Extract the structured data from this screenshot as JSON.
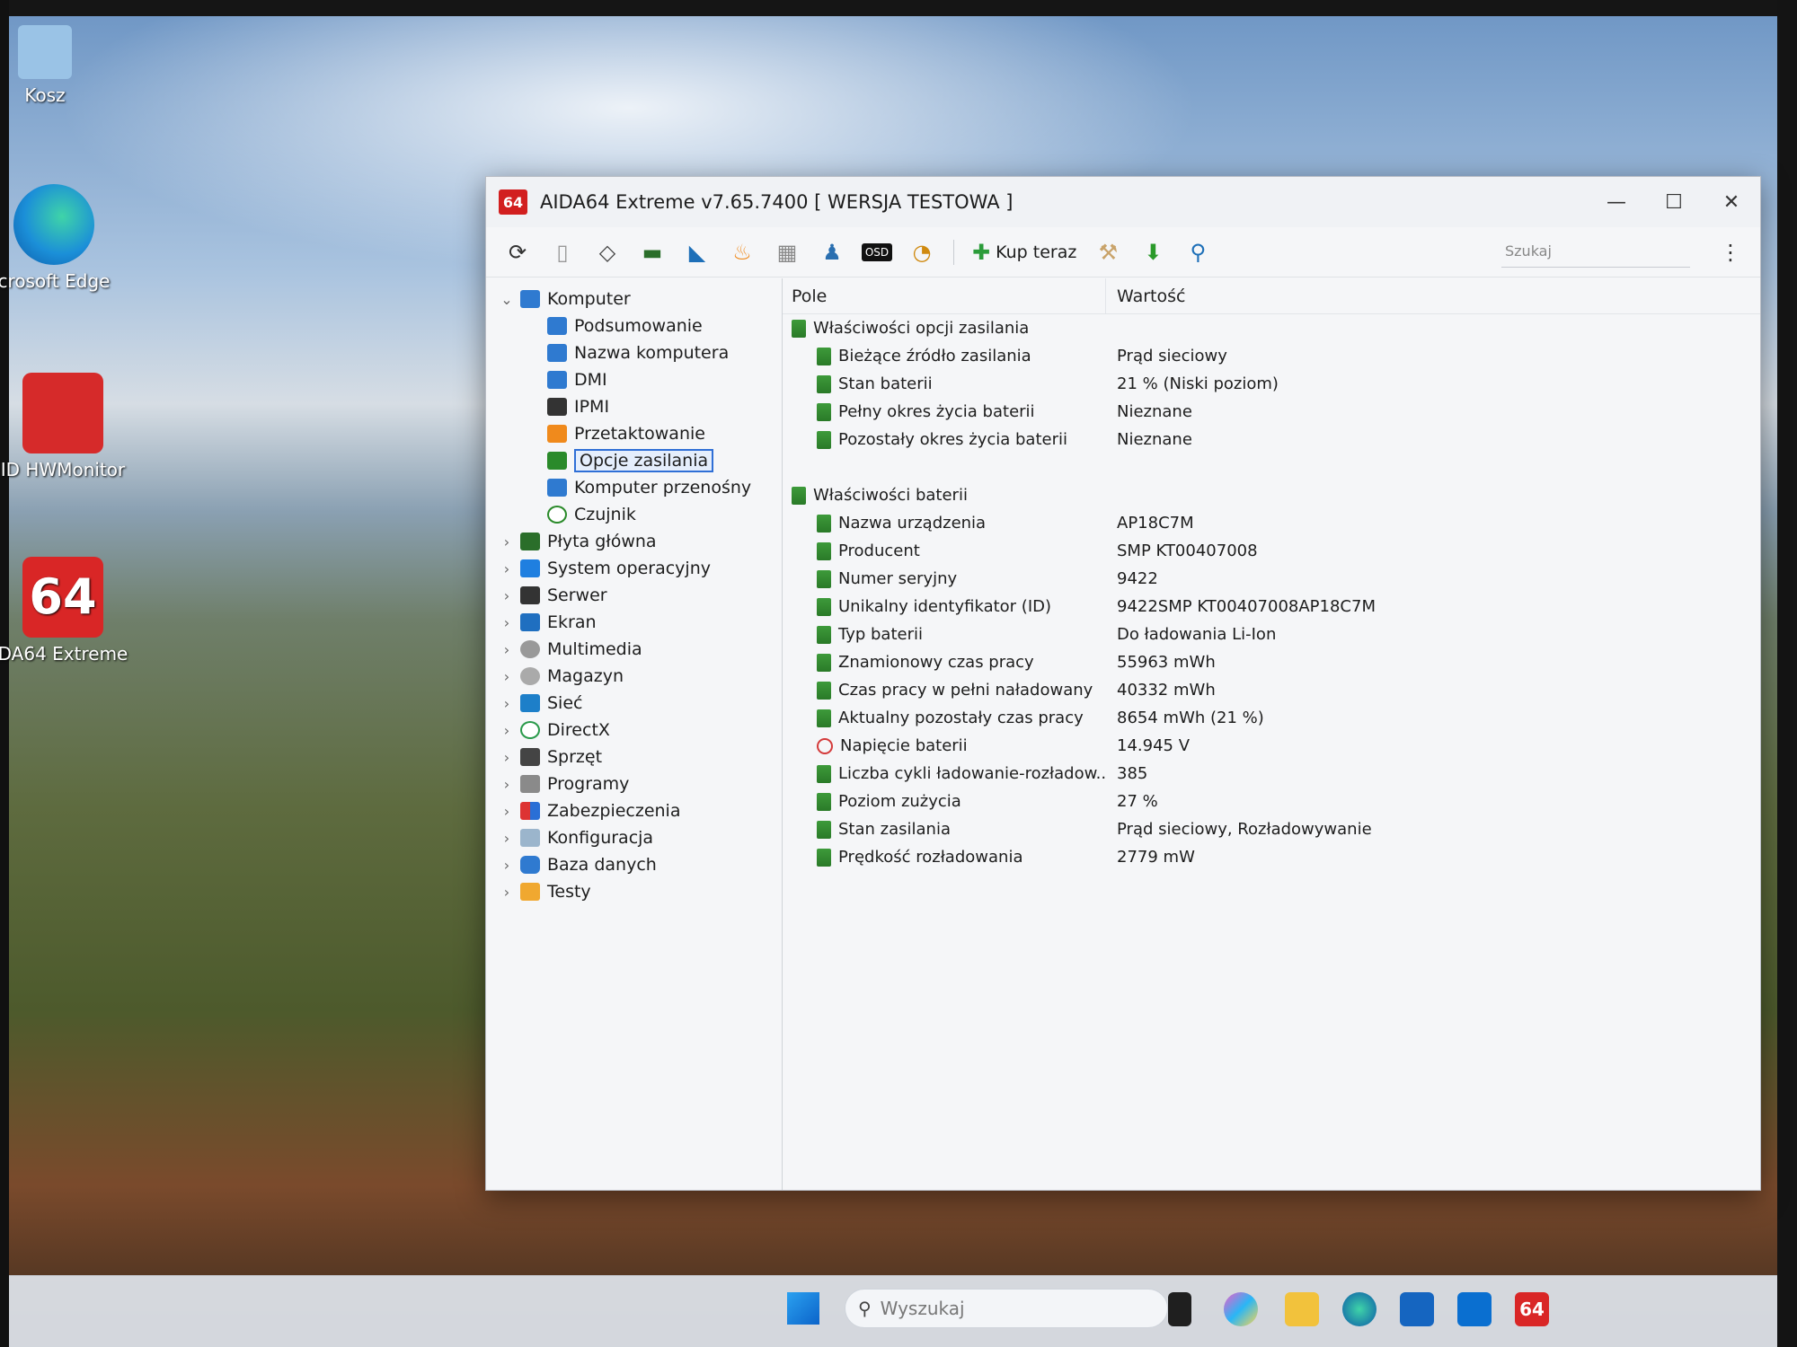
{
  "desktop": {
    "icons": [
      {
        "label": "Kosz",
        "icon": "recycle-bin-icon"
      },
      {
        "label": "crosoft Edge",
        "icon": "edge-icon"
      },
      {
        "label": "ID HWMonitor",
        "icon": "hwmonitor-icon"
      },
      {
        "label": "DA64 Extreme",
        "icon": "aida64-icon"
      }
    ]
  },
  "window": {
    "logo": "64",
    "title": "AIDA64 Extreme v7.65.7400  [ WERSJA TESTOWA ]",
    "controls": {
      "minimize": "—",
      "maximize": "☐",
      "close": "✕"
    }
  },
  "toolbar": {
    "buy_label": "Kup teraz",
    "search_placeholder": "Szukaj",
    "more": "⋮"
  },
  "tree": {
    "root": {
      "label": "Komputer"
    },
    "children": [
      {
        "label": "Podsumowanie"
      },
      {
        "label": "Nazwa komputera"
      },
      {
        "label": "DMI"
      },
      {
        "label": "IPMI"
      },
      {
        "label": "Przetaktowanie"
      },
      {
        "label": "Opcje zasilania"
      },
      {
        "label": "Komputer przenośny"
      },
      {
        "label": "Czujnik"
      }
    ],
    "sections": [
      {
        "label": "Płyta główna"
      },
      {
        "label": "System operacyjny"
      },
      {
        "label": "Serwer"
      },
      {
        "label": "Ekran"
      },
      {
        "label": "Multimedia"
      },
      {
        "label": "Magazyn"
      },
      {
        "label": "Sieć"
      },
      {
        "label": "DirectX"
      },
      {
        "label": "Sprzęt"
      },
      {
        "label": "Programy"
      },
      {
        "label": "Zabezpieczenia"
      },
      {
        "label": "Konfiguracja"
      },
      {
        "label": "Baza danych"
      },
      {
        "label": "Testy"
      }
    ]
  },
  "list": {
    "col_field": "Pole",
    "col_value": "Wartość",
    "group1": {
      "title": "Właściwości opcji zasilania",
      "rows": [
        {
          "field": "Bieżące źródło zasilania",
          "value": "Prąd sieciowy"
        },
        {
          "field": "Stan baterii",
          "value": "21 % (Niski poziom)"
        },
        {
          "field": "Pełny okres życia baterii",
          "value": "Nieznane"
        },
        {
          "field": "Pozostały okres życia baterii",
          "value": "Nieznane"
        }
      ]
    },
    "group2": {
      "title": "Właściwości baterii",
      "rows": [
        {
          "field": "Nazwa urządzenia",
          "value": "AP18C7M"
        },
        {
          "field": "Producent",
          "value": "SMP KT00407008"
        },
        {
          "field": "Numer seryjny",
          "value": "9422"
        },
        {
          "field": "Unikalny identyfikator (ID)",
          "value": "9422SMP KT00407008AP18C7M"
        },
        {
          "field": "Typ baterii",
          "value": "Do ładowania Li-Ion"
        },
        {
          "field": "Znamionowy czas pracy",
          "value": "55963 mWh"
        },
        {
          "field": "Czas pracy w pełni naładowany",
          "value": "40332 mWh"
        },
        {
          "field": "Aktualny pozostały czas pracy",
          "value": "8654 mWh  (21 %)"
        },
        {
          "field": "Napięcie baterii",
          "value": "14.945 V"
        },
        {
          "field": "Liczba cykli ładowanie-rozładow...",
          "value": "385"
        },
        {
          "field": "Poziom zużycia",
          "value": "27 %"
        },
        {
          "field": "Stan zasilania",
          "value": "Prąd sieciowy, Rozładowywanie"
        },
        {
          "field": "Prędkość rozładowania",
          "value": "2779 mW"
        }
      ]
    }
  },
  "taskbar": {
    "search_placeholder": "Wyszukaj"
  }
}
